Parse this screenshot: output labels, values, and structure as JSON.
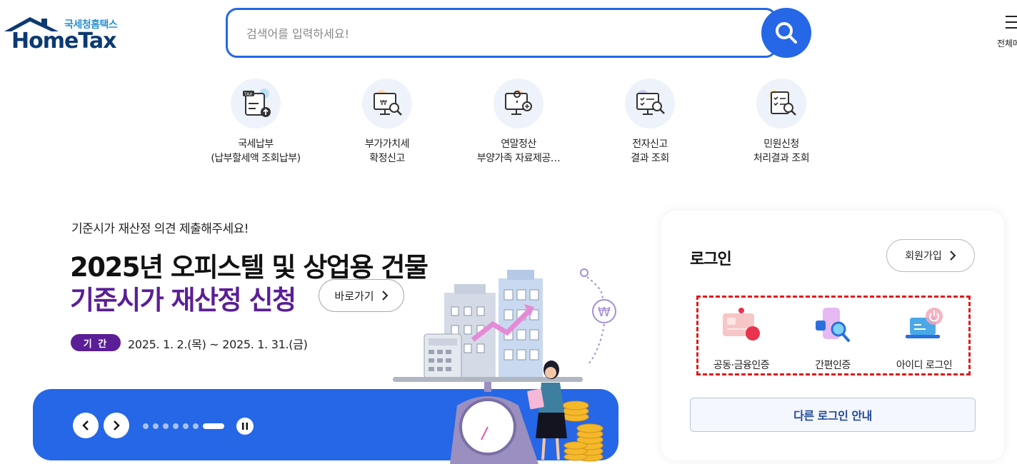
{
  "header": {
    "logo_kr": "국세청홈택스",
    "logo_en": "HomeTax",
    "search_placeholder": "검색어를 입력하세요!",
    "menu_all_label": "전체메뉴"
  },
  "quick_menu": [
    {
      "line1": "국세납부",
      "line2": "(납부할세액 조회납부)",
      "icon": "tax-payment-icon"
    },
    {
      "line1": "부가가치세",
      "line2": "확정신고",
      "icon": "vat-monitor-icon"
    },
    {
      "line1": "연말정산",
      "line2": "부양가족 자료제공…",
      "icon": "year-end-settlement-icon"
    },
    {
      "line1": "전자신고",
      "line2": "결과 조회",
      "icon": "e-filing-result-icon"
    },
    {
      "line1": "민원신청",
      "line2": "처리결과 조회",
      "icon": "civil-petition-icon"
    }
  ],
  "banner": {
    "subtitle": "기준시가 재산정 의견 제출해주세요!",
    "title_line1": "2025년 오피스텔 및 상업용 건물",
    "title_line2": "기준시가 재산정 신청",
    "goto_label": "바로가기",
    "period_badge": "기 간",
    "period_text": "2025. 1. 2.(목) ~ 2025. 1. 31.(금)",
    "slide_count": 7,
    "active_slide": 7,
    "colors": {
      "accent": "#2567e6",
      "purple": "#5a1e96"
    }
  },
  "login": {
    "title": "로그인",
    "join_label": "회원가입",
    "options": [
      {
        "label": "공동·금융인증",
        "icon": "certificate-card-icon"
      },
      {
        "label": "간편인증",
        "icon": "simple-auth-phone-icon"
      },
      {
        "label": "아이디 로그인",
        "icon": "id-login-laptop-icon"
      }
    ],
    "other_label": "다른 로그인 안내"
  }
}
